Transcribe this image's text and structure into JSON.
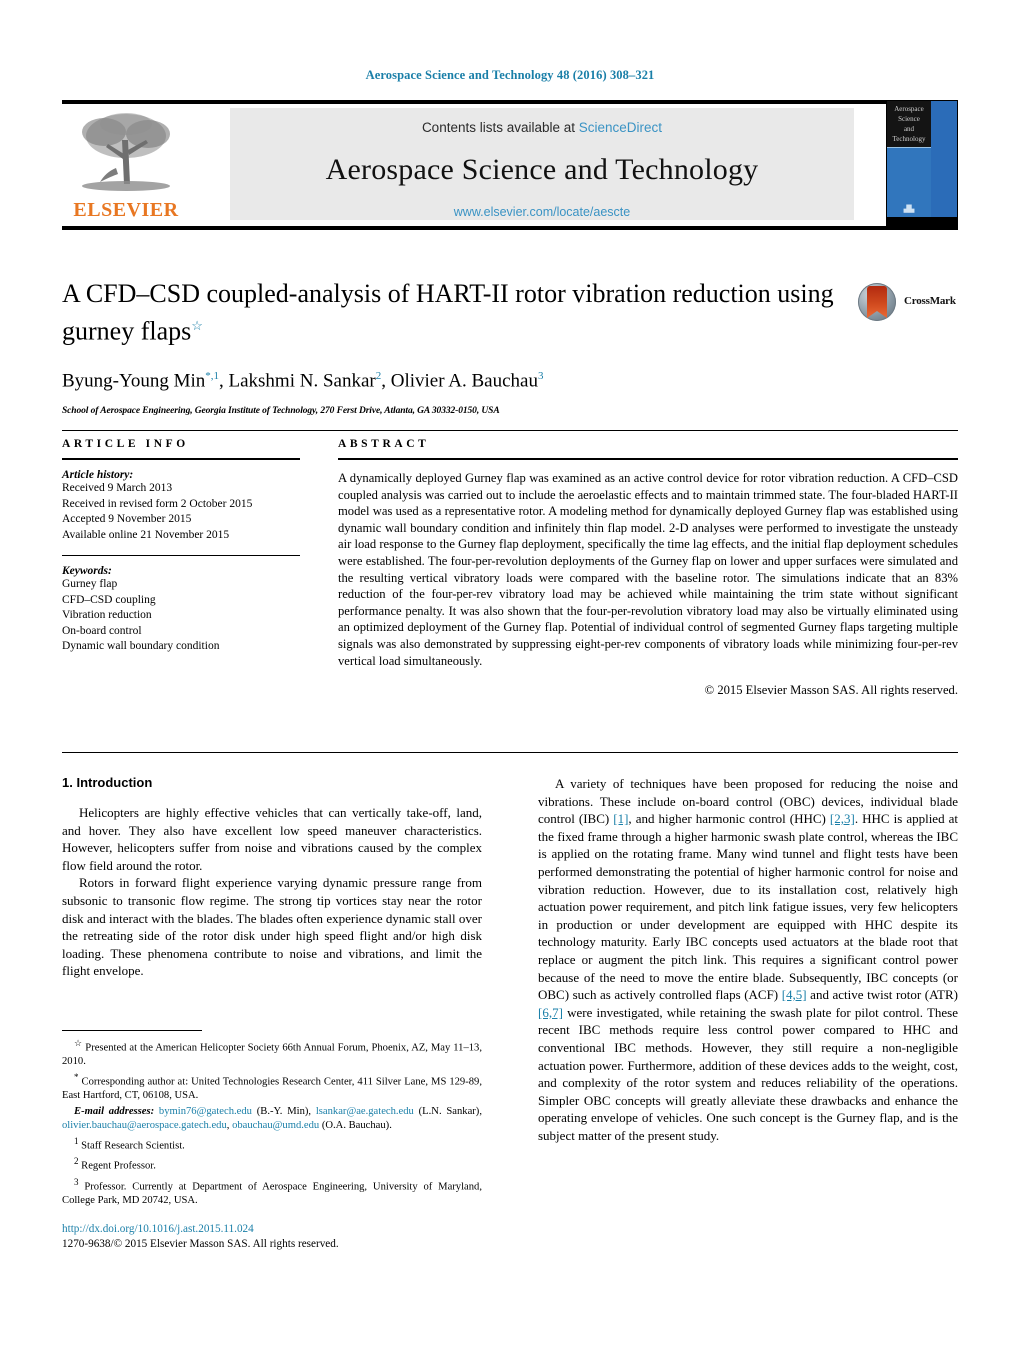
{
  "running_head": "Aerospace Science and Technology 48 (2016) 308–321",
  "masthead": {
    "contents_prefix": "Contents lists available at ",
    "sciencedirect": "ScienceDirect",
    "journal_name": "Aerospace Science and Technology",
    "journal_url": "www.elsevier.com/locate/aescte",
    "publisher_wordmark": "ELSEVIER",
    "cover_title_lines": [
      "Aerospace",
      "Science",
      "and",
      "Technology"
    ]
  },
  "colors": {
    "link_blue": "#1a7fa8",
    "sciencedirect_blue": "#3a93c4",
    "elsevier_orange": "#E87722",
    "cover_blue": "#2b6cb8"
  },
  "title": {
    "line1": "A CFD–CSD coupled-analysis of HART-II rotor vibration reduction using",
    "line2": "gurney flaps",
    "footnote_marker": "☆"
  },
  "crossmark": {
    "label": "CrossMark"
  },
  "authors": {
    "a1_name": "Byung-Young Min",
    "a1_sup": "*,1",
    "a2_name": "Lakshmi N. Sankar",
    "a2_sup": "2",
    "a3_name": "Olivier A. Bauchau",
    "a3_sup": "3",
    "separator": ", "
  },
  "affiliation": "School of Aerospace Engineering, Georgia Institute of Technology, 270 Ferst Drive, Atlanta, GA 30332-0150, USA",
  "article_info": {
    "heading": "ARTICLE INFO",
    "history_label": "Article history:",
    "history": [
      "Received 9 March 2013",
      "Received in revised form 2 October 2015",
      "Accepted 9 November 2015",
      "Available online 21 November 2015"
    ],
    "keywords_label": "Keywords:",
    "keywords": [
      "Gurney flap",
      "CFD–CSD coupling",
      "Vibration reduction",
      "On-board control",
      "Dynamic wall boundary condition"
    ]
  },
  "abstract": {
    "heading": "ABSTRACT",
    "text": "A dynamically deployed Gurney flap was examined as an active control device for rotor vibration reduction. A CFD–CSD coupled analysis was carried out to include the aeroelastic effects and to maintain trimmed state. The four-bladed HART-II model was used as a representative rotor. A modeling method for dynamically deployed Gurney flap was established using dynamic wall boundary condition and infinitely thin flap model. 2-D analyses were performed to investigate the unsteady air load response to the Gurney flap deployment, specifically the time lag effects, and the initial flap deployment schedules were established. The four-per-revolution deployments of the Gurney flap on lower and upper surfaces were simulated and the resulting vertical vibratory loads were compared with the baseline rotor. The simulations indicate that an 83% reduction of the four-per-rev vibratory load may be achieved while maintaining the trim state without significant performance penalty. It was also shown that the four-per-revolution vibratory load may also be virtually eliminated using an optimized deployment of the Gurney flap. Potential of individual control of segmented Gurney flaps targeting multiple signals was also demonstrated by suppressing eight-per-rev components of vibratory loads while minimizing four-per-rev vertical load simultaneously.",
    "copyright": "© 2015 Elsevier Masson SAS. All rights reserved."
  },
  "body": {
    "section_heading": "1. Introduction",
    "left_p1": "Helicopters are highly effective vehicles that can vertically take-off, land, and hover. They also have excellent low speed maneuver characteristics. However, helicopters suffer from noise and vibrations caused by the complex flow field around the rotor.",
    "left_p2": "Rotors in forward flight experience varying dynamic pressure range from subsonic to transonic flow regime. The strong tip vortices stay near the rotor disk and interact with the blades. The blades often experience dynamic stall over the retreating side of the rotor disk under high speed flight and/or high disk loading. These phenomena contribute to noise and vibrations, and limit the flight envelope.",
    "right_p1_a": "A variety of techniques have been proposed for reducing the noise and vibrations. These include on-board control (OBC) devices, individual blade control (IBC) ",
    "right_ref1": "[1]",
    "right_p1_b": ", and higher harmonic control (HHC) ",
    "right_ref2": "[2,3]",
    "right_p1_c": ". HHC is applied at the fixed frame through a higher harmonic swash plate control, whereas the IBC is applied on the rotating frame. Many wind tunnel and flight tests have been performed demonstrating the potential of higher harmonic control for noise and vibration reduction. However, due to its installation cost, relatively high actuation power requirement, and pitch link fatigue issues, very few helicopters in production or under development are equipped with HHC despite its technology maturity. Early IBC concepts used actuators at the blade root that replace or augment the pitch link. This requires a significant control power because of the need to move the entire blade. Subsequently, IBC concepts (or OBC) such as actively controlled flaps (ACF) ",
    "right_ref3": "[4,5]",
    "right_p1_d": " and active twist rotor (ATR) ",
    "right_ref4": "[6,7]",
    "right_p1_e": " were investigated, while retaining the swash plate for pilot control. These recent IBC methods require less control power compared to HHC and conventional IBC methods. However, they still require a non-negligible actuation power. Furthermore, addition of these devices adds to the weight, cost, and complexity of the rotor system and reduces reliability of the operations. Simpler OBC concepts will greatly alleviate these drawbacks and enhance the operating envelope of vehicles. One such concept is the Gurney flap, and is the subject matter of the present study."
  },
  "footnotes": {
    "fn_star_sym": "☆",
    "fn_star": "Presented at the American Helicopter Society 66th Annual Forum, Phoenix, AZ, May 11–13, 2010.",
    "fn_corr_sym": "*",
    "fn_corr": "Corresponding author at: United Technologies Research Center, 411 Silver Lane, MS 129-89, East Hartford, CT, 06108, USA.",
    "email_label": "E-mail addresses:",
    "email1": "bymin76@gatech.edu",
    "email1_who": " (B.-Y. Min), ",
    "email2": "lsankar@ae.gatech.edu",
    "email2_who": " (L.N. Sankar), ",
    "email3": "olivier.bauchau@aerospace.gatech.edu",
    "email_sep": ", ",
    "email4": "obauchau@umd.edu",
    "email4_who": " (O.A. Bauchau).",
    "fn1_sym": "1",
    "fn1": "Staff Research Scientist.",
    "fn2_sym": "2",
    "fn2": "Regent Professor.",
    "fn3_sym": "3",
    "fn3": "Professor. Currently at Department of Aerospace Engineering, University of Maryland, College Park, MD 20742, USA."
  },
  "doi": {
    "url": "http://dx.doi.org/10.1016/j.ast.2015.11.024",
    "issn_line": "1270-9638/© 2015 Elsevier Masson SAS. All rights reserved."
  }
}
